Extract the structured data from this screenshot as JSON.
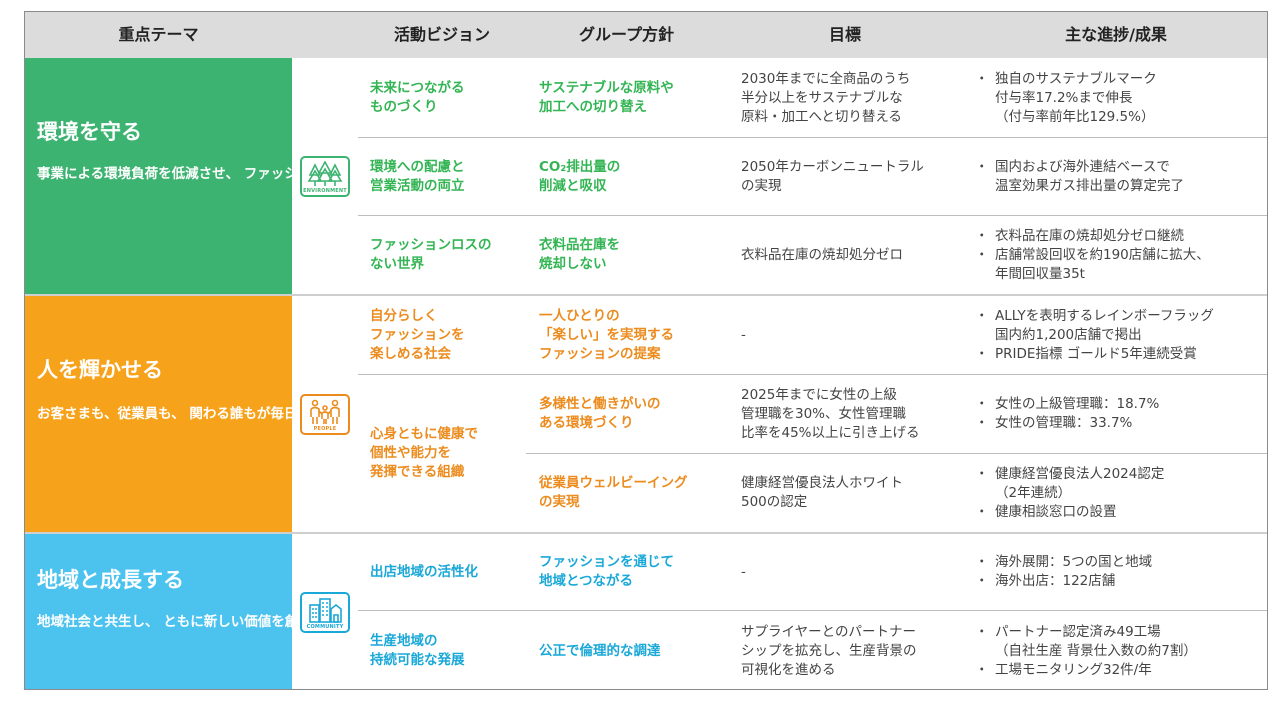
{
  "headers": {
    "theme": "重点テーマ",
    "vision": "活動ビジョン",
    "policy": "グループ方針",
    "goal": "目標",
    "progress": "主な進捗/成果"
  },
  "colors": {
    "environment": "#3cb371",
    "people": "#f7a21b",
    "community": "#4cc3ef"
  },
  "sections": [
    {
      "title": "環境を守る",
      "description": "事業による環境負荷を低減させ、\nファッションの世界を\nサステナブルにします。",
      "icon": "trees-icon",
      "icon_label": "ENVIRONMENT",
      "rows": [
        {
          "vision": "未来につながる\nものづくり",
          "policy": "サステナブルな原料や\n加工への切り替え",
          "goal": "2030年までに全商品のうち\n半分以上をサステナブルな\n原料・加工へと切り替える",
          "progress": [
            "独自のサステナブルマーク\n付与率17.2%まで伸長\n（付与率前年比129.5%）"
          ]
        },
        {
          "vision": "環境への配慮と\n営業活動の両立",
          "policy": "CO₂排出量の\n削減と吸収",
          "goal": "2050年カーボンニュートラル\nの実現",
          "progress": [
            "国内および海外連結ベースで\n温室効果ガス排出量の算定完了"
          ]
        },
        {
          "vision": "ファッションロスの\nない世界",
          "policy": "衣料品在庫を\n焼却しない",
          "goal": "衣料品在庫の焼却処分ゼロ",
          "progress": [
            "衣料品在庫の焼却処分ゼロ継続",
            "店舗常設回収を約190店舗に拡大、\n年間回収量35t"
          ]
        }
      ]
    },
    {
      "title": "人を輝かせる",
      "description": "お客さまも、従業員も、\n関わる誰もが毎日ワクワク\nできる環境をつくります。",
      "icon": "people-icon",
      "icon_label": "PEOPLE",
      "rows": [
        {
          "vision": "自分らしく\nファッションを\n楽しめる社会",
          "policy": "一人ひとりの\n「楽しい」を実現する\nファッションの提案",
          "goal": "-",
          "progress": [
            "ALLYを表明するレインボーフラッグ\n国内約1,200店舗で掲出",
            "PRIDE指標 ゴールド5年連続受賞"
          ]
        },
        {
          "vision": "心身ともに健康で\n個性や能力を\n発揮できる組織",
          "policy": "多様性と働きがいの\nある環境づくり",
          "goal": "2025年までに女性の上級\n管理職を30%、女性管理職\n比率を45%以上に引き上げる",
          "progress": [
            "女性の上級管理職：18.7%",
            "女性の管理職：33.7%"
          ]
        },
        {
          "vision": "",
          "policy": "従業員ウェルビーイング\nの実現",
          "goal": "健康経営優良法人ホワイト\n500の認定",
          "progress": [
            "健康経営優良法人2024認定\n（2年連続）",
            "健康相談窓口の設置"
          ]
        }
      ]
    },
    {
      "title": "地域と成長する",
      "description": "地域社会と共生し、\nともに新しい価値を創ります。",
      "icon": "buildings-icon",
      "icon_label": "COMMUNITY",
      "rows": [
        {
          "vision": "出店地域の活性化",
          "policy": "ファッションを通じて\n地域とつながる",
          "goal": "-",
          "progress": [
            "海外展開：5つの国と地域",
            "海外出店：122店舗"
          ]
        },
        {
          "vision": "生産地域の\n持続可能な発展",
          "policy": "公正で倫理的な調達",
          "goal": "サプライヤーとのパートナー\nシップを拡充し、生産背景の\n可視化を進める",
          "progress": [
            "パートナー認定済み49工場\n（自社生産 背景仕入数の約7割）",
            "工場モニタリング32件/年"
          ]
        }
      ]
    }
  ]
}
